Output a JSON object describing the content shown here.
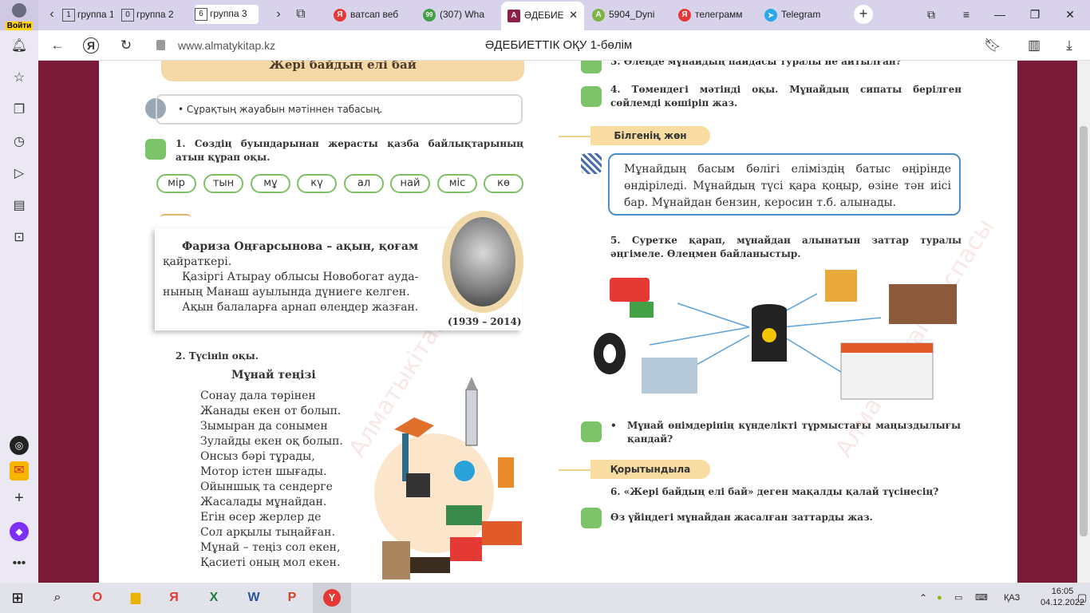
{
  "browser": {
    "account_label": "Войти",
    "tabs": [
      {
        "num": "1",
        "label": "группа 1"
      },
      {
        "num": "0",
        "label": "группа 2"
      },
      {
        "num": "6",
        "label": "группа 3"
      }
    ],
    "site_tabs": [
      {
        "label": "ватсап веб",
        "icon_color": "#e53935",
        "glyph": "Я"
      },
      {
        "label": "(307) Wha",
        "icon_color": "#43a047",
        "glyph": "99"
      },
      {
        "label": "ӘДЕБИЕ",
        "icon_color": "#8e1f47",
        "glyph": "A"
      },
      {
        "label": "5904_Dyni",
        "icon_color": "#7cb342",
        "glyph": "A"
      },
      {
        "label": "телеграмм",
        "icon_color": "#e53935",
        "glyph": "Я"
      },
      {
        "label": "Telegram",
        "icon_color": "#29a9eb",
        "glyph": "➤"
      }
    ],
    "address": "www.almatykitap.kz",
    "page_title": "ӘДЕБИЕТТІК ОҚУ 1-бөлім"
  },
  "page": {
    "header": "Жері байдың елі бай",
    "tip": "• Сұрақтың жауабын мәтіннен табасың.",
    "task1": "1. Сөздің буындарынан жерасты қазба байлықтарының атын құрап оқы.",
    "syllables": [
      "мір",
      "тын",
      "мұ",
      "кү",
      "ал",
      "най",
      "міс",
      "кө"
    ],
    "bio_lines": [
      "Фариза Оңғарсынова – ақын, қоғам",
      "қайраткері.",
      "Қазіргі Атырау облысы Новобогат ауда-",
      "нының Манаш ауылында дүниеге келген.",
      "Ақын балаларға арнап өлеңдер жазған."
    ],
    "years": "(1939 – 2014)",
    "task2": "2. Түсініп оқы.",
    "poem_title": "Мұнай теңізі",
    "poem_lines": [
      "Сонау дала төрінен",
      "Жанады екен от болып.",
      "Зымыран да сонымен",
      "Зулайды екен оқ болып.",
      "Онсыз бәрі тұрады,",
      "Мотор істен шығады.",
      "Ойыншық та сендерге",
      "Жасалады мұнайдан.",
      "Егін өсер жерлер де",
      "Сол арқылы тыңайған.",
      "Мұнай – теңіз сол екен,",
      "Қасиеті оның мол екен."
    ],
    "task3": "3. Өлеңде мұнайдың пайдасы туралы не айтылған?",
    "task4": "4. Төмендегі мәтінді оқы. Мұнайдың сипаты берілген сөйлемді көшіріп жаз.",
    "know_label": "Білгенің жөн",
    "know_text": "Мұнайдың басым бөлігі еліміздің батыс өңірінде өндіріледі. Мұнайдың түсі қара қоңыр, өзіне тән иісі бар. Мұнайдан бензин, керосин т.б. алынады.",
    "task5": "5. Суретке қарап, мұнайдан алынатын заттар туралы әңгімеле. Өлеңмен байланыстыр.",
    "bullet_q": "Мұнай өнімдерінің күнделікті тұрмыстағы маңыздылығы қандай?",
    "summary_label": "Қорытындыла",
    "task6": "6. «Жері байдың елі бай» деген мақалды қалай түсінесің?",
    "home_task": "Өз үйіңдегі мұнайдан жасалған заттарды жаз.",
    "watermark": "Алматыкітап баспасы"
  },
  "taskbar": {
    "lang": "ҚАЗ",
    "time": "16:05",
    "date": "04.12.2022"
  }
}
